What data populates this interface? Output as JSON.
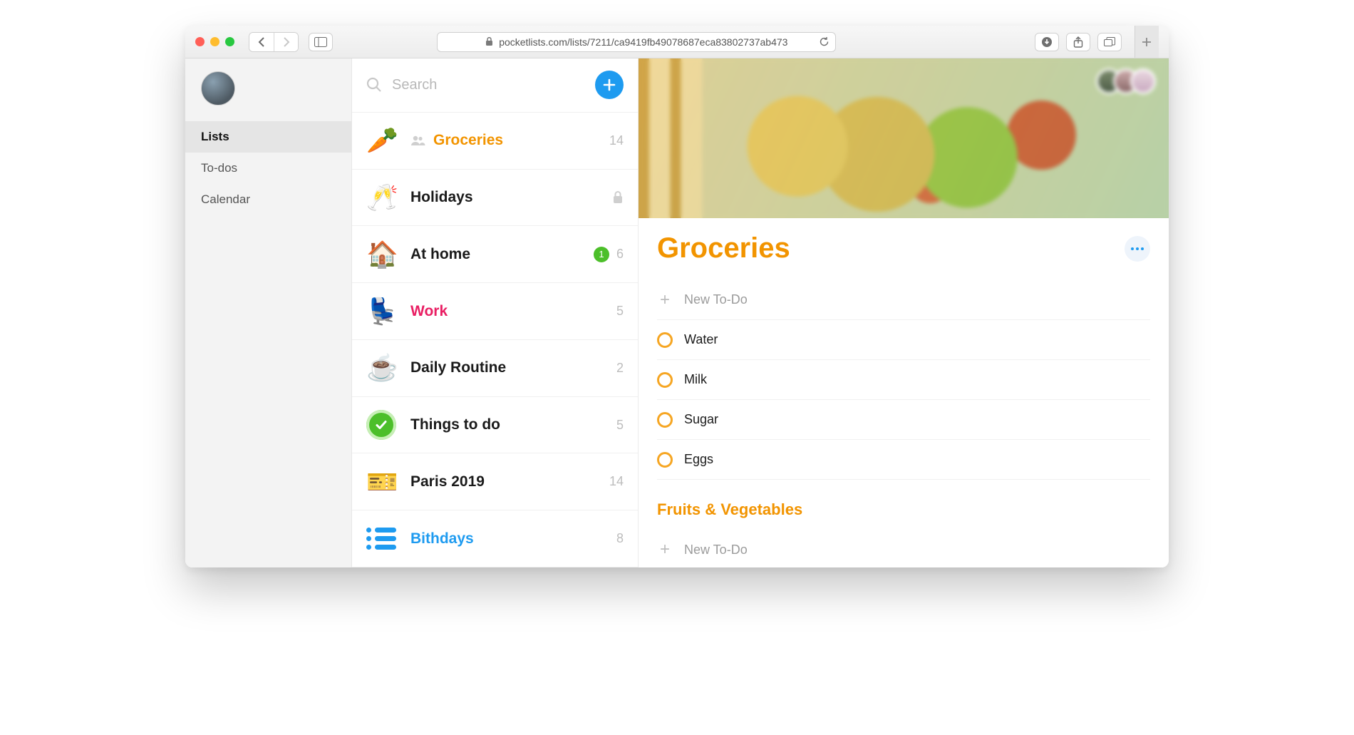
{
  "browser": {
    "url": "pocketlists.com/lists/7211/ca9419fb49078687eca83802737ab473"
  },
  "nav": {
    "items": [
      {
        "label": "Lists",
        "active": true
      },
      {
        "label": "To-dos",
        "active": false
      },
      {
        "label": "Calendar",
        "active": false
      }
    ]
  },
  "search": {
    "placeholder": "Search"
  },
  "lists": [
    {
      "emoji": "🥕",
      "name": "Groceries",
      "count": 14,
      "selected": true,
      "shared": true
    },
    {
      "emoji": "🥂",
      "name": "Holidays",
      "locked": true
    },
    {
      "emoji": "🏠",
      "name": "At home",
      "count": 6,
      "badge": 1
    },
    {
      "emoji": "💺",
      "name": "Work",
      "count": 5,
      "color": "pink"
    },
    {
      "emoji": "☕",
      "name": "Daily Routine",
      "count": 2
    },
    {
      "icon": "check",
      "name": "Things to do",
      "count": 5
    },
    {
      "emoji": "🎫",
      "name": "Paris 2019",
      "count": 14
    },
    {
      "icon": "list",
      "name": "Bithdays",
      "count": 8,
      "color": "blue"
    }
  ],
  "detail": {
    "title": "Groceries",
    "new_todo_label": "New To-Do",
    "collaborators": 3,
    "todos": [
      {
        "text": "Water"
      },
      {
        "text": "Milk"
      },
      {
        "text": "Sugar"
      },
      {
        "text": "Eggs"
      }
    ],
    "sections": [
      {
        "heading": "Fruits & Vegetables"
      }
    ]
  }
}
